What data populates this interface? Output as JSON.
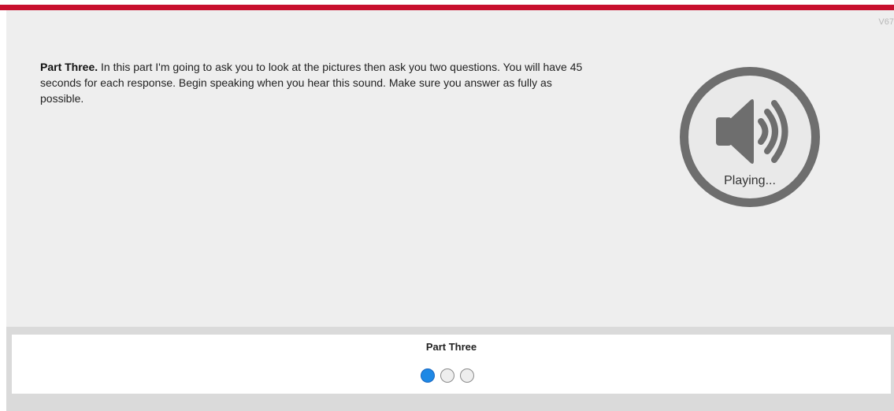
{
  "header": {
    "version_label": "V67"
  },
  "instructions": {
    "heading": "Part Three.",
    "body": " In this part I'm going to ask you to look at the pictures then ask you two questions. You will have 45 seconds for each response. Begin speaking when you hear this sound. Make sure you answer as fully as possible."
  },
  "audio": {
    "status_label": "Playing...",
    "icon": "speaker-volume-icon"
  },
  "footer": {
    "section_title": "Part Three",
    "progress": {
      "current": 1,
      "total": 3
    }
  },
  "colors": {
    "top_bar": "#c8102e",
    "active_dot": "#1e88e5",
    "speaker_gray": "#6e6e6e"
  }
}
